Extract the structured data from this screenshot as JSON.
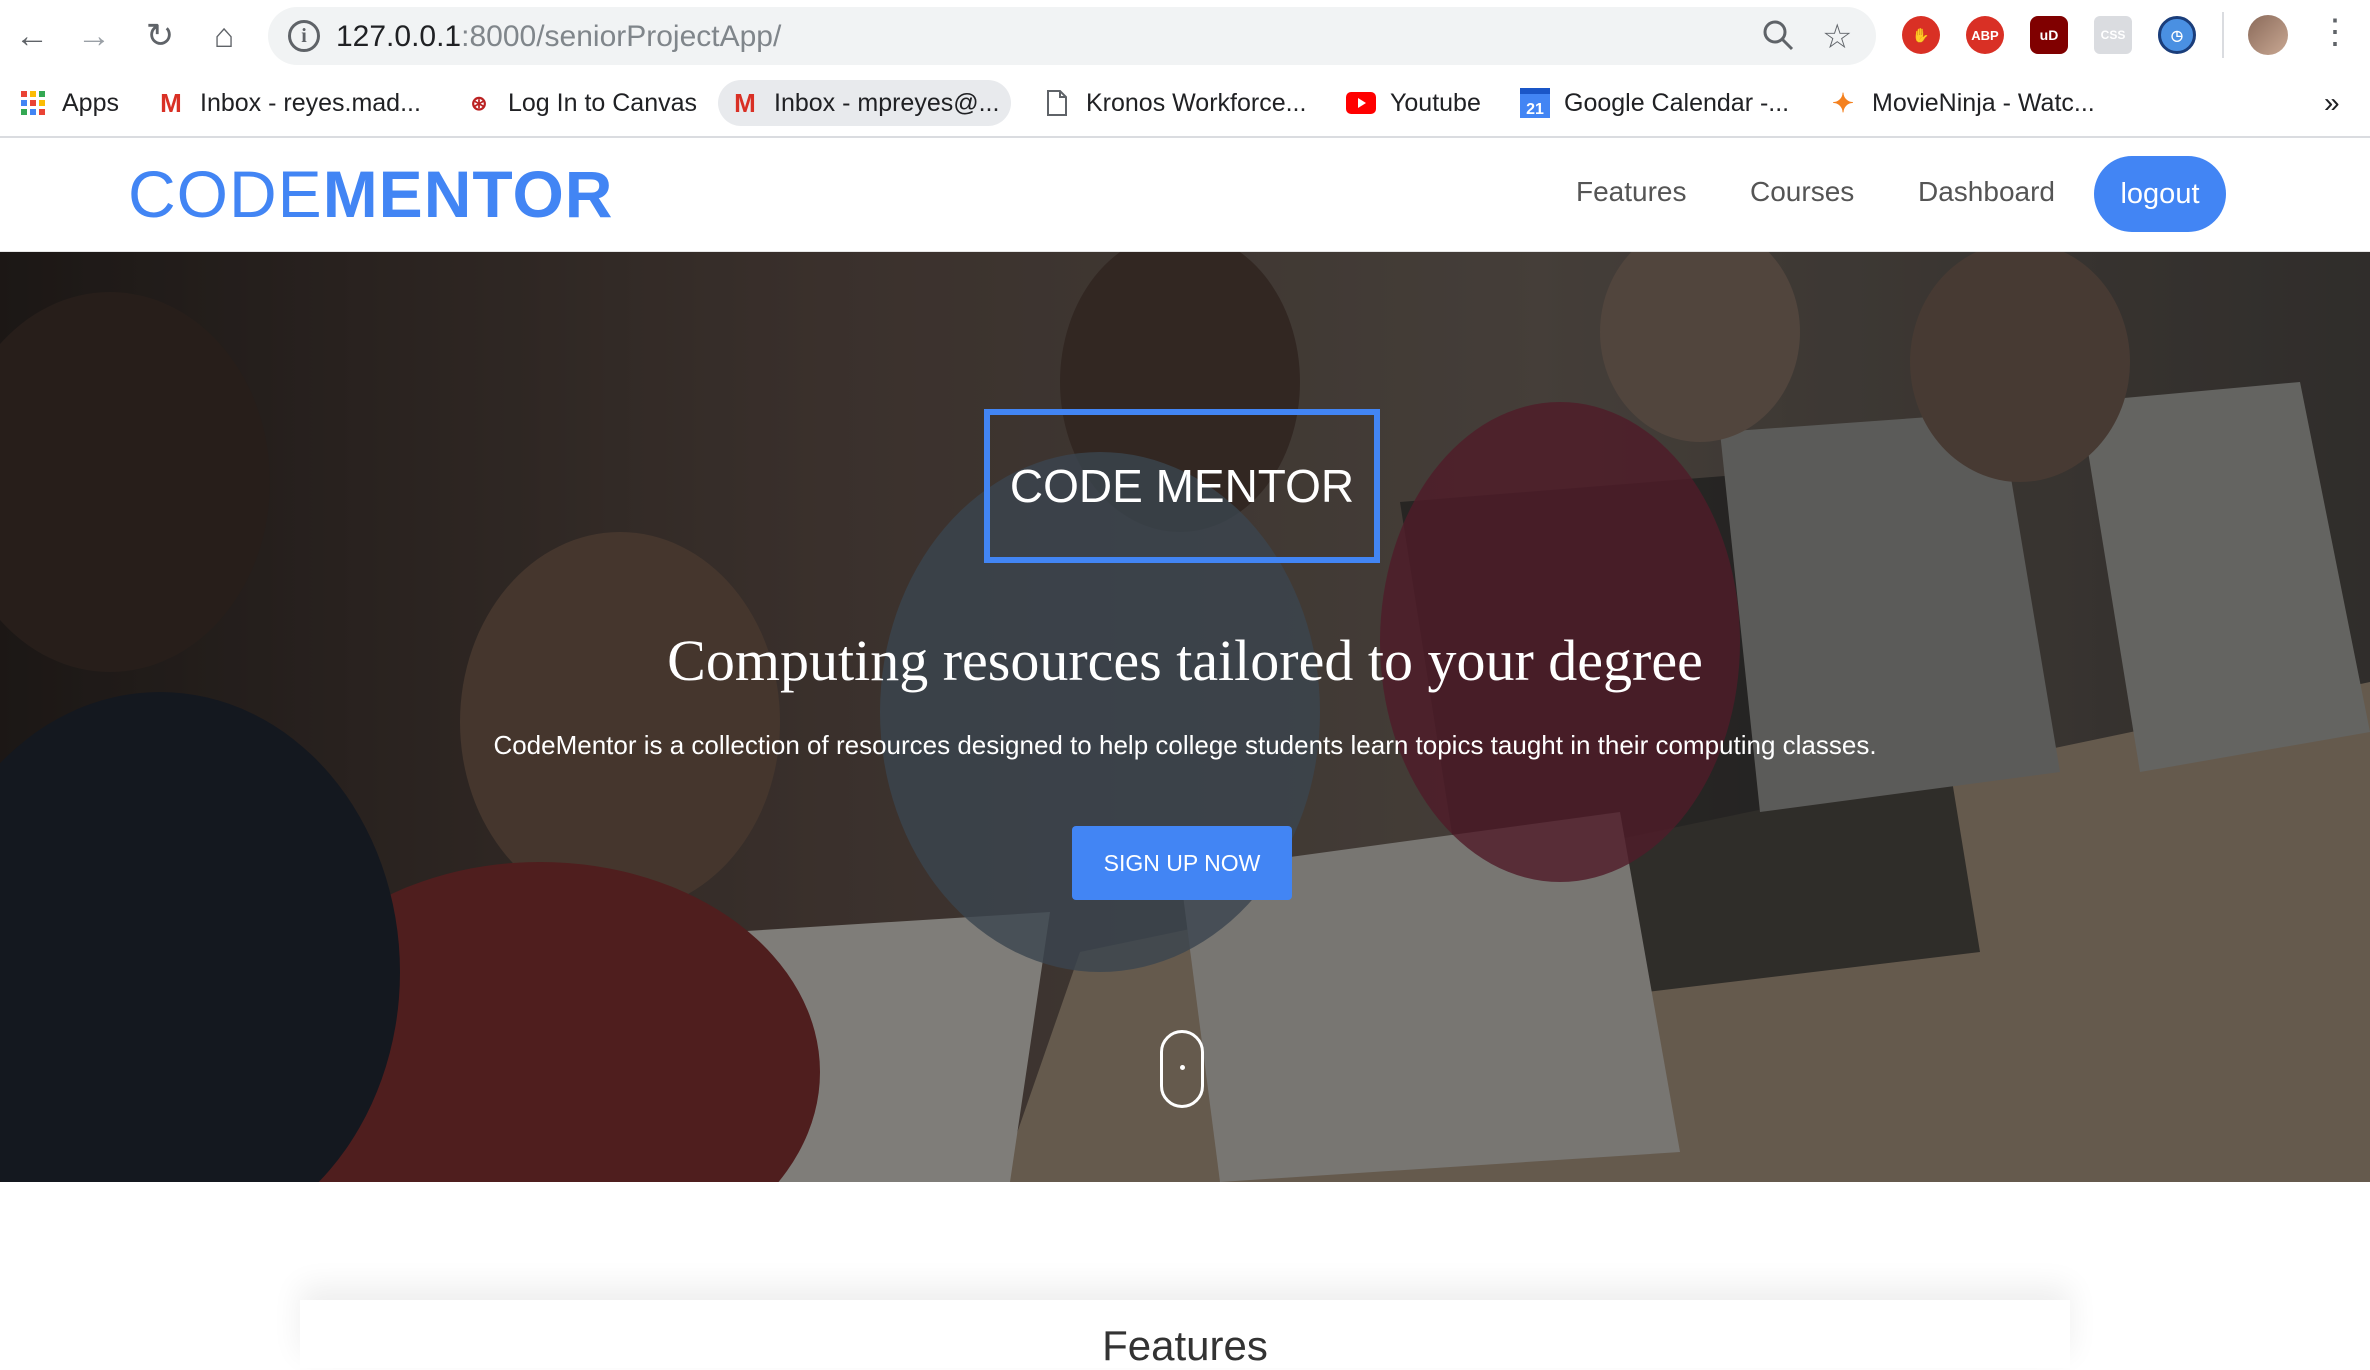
{
  "browser": {
    "url_host": "127.0.0.1",
    "url_path": ":8000/seniorProjectApp/",
    "nav_icons": [
      "back-icon",
      "forward-icon",
      "reload-icon",
      "home-icon"
    ],
    "extensions": [
      {
        "name": "stop-hand-icon",
        "label": "",
        "color": "#d93025"
      },
      {
        "name": "adblock-plus-icon",
        "label": "ABP",
        "color": "#d93025"
      },
      {
        "name": "ublock-icon",
        "label": "uD",
        "color": "#800000"
      },
      {
        "name": "css-extension-icon",
        "label": "CSS",
        "color": "#9aa0a6"
      },
      {
        "name": "history-clock-icon",
        "label": "",
        "color": "#4a90e2"
      }
    ]
  },
  "bookmarks": {
    "items": [
      {
        "label": "Apps",
        "icon": "apps-grid-icon"
      },
      {
        "label": "Inbox - reyes.mad...",
        "icon": "gmail-icon"
      },
      {
        "label": "Log In to Canvas",
        "icon": "canvas-icon"
      },
      {
        "label": "Inbox - mpreyes@...",
        "icon": "gmail-icon"
      },
      {
        "label": "Kronos Workforce...",
        "icon": "document-icon"
      },
      {
        "label": "Youtube",
        "icon": "youtube-icon"
      },
      {
        "label": "Google Calendar -...",
        "icon": "calendar-icon",
        "icon_text": "21"
      },
      {
        "label": "MovieNinja - Watc...",
        "icon": "movieninja-icon"
      }
    ],
    "overflow": "»"
  },
  "site": {
    "logo_light": "CODE",
    "logo_bold": "MENTOR",
    "nav": [
      "Features",
      "Courses",
      "Dashboard"
    ],
    "logout": "logout",
    "accent": "#4285f4"
  },
  "hero": {
    "box_title": "CODE MENTOR",
    "title": "Computing resources tailored to your degree",
    "subtitle": "CodeMentor is a collection of resources designed to help college students learn topics taught in their computing classes.",
    "cta": "SIGN UP NOW"
  },
  "features": {
    "title": "Features"
  }
}
